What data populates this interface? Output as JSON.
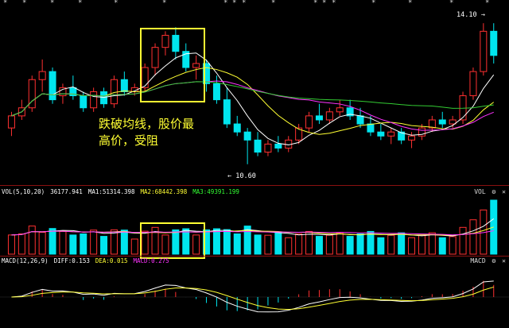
{
  "stars": [
    "*",
    "*",
    "*",
    "*",
    "*",
    "*",
    "*",
    "*",
    "*",
    "*",
    "*",
    "*",
    "*",
    "*",
    "*",
    "*",
    "*"
  ],
  "main": {
    "annotation_line1": "跌破均线，股价最",
    "annotation_line2": "高价，受阻",
    "high_label": "14.10",
    "low_label": "10.60"
  },
  "volume": {
    "title": "VOL(5,10,20)",
    "value": "36177.941",
    "ma1": "MA1:51314.398",
    "ma2": "MA2:68442.398",
    "ma3": "MA3:49391.199",
    "corner": "VOL"
  },
  "macd": {
    "title": "MACD(12,26,9)",
    "diff": "DIFF:0.153",
    "dea": "DEA:0.015",
    "macd_val": "MACD:0.275",
    "corner": "MACD"
  },
  "controls": {
    "settings": "⚙",
    "close": "✕"
  },
  "colors": {
    "up": "#ff3030",
    "down": "#00e5ee",
    "ma5": "#ffffff",
    "ma10": "#ffff33",
    "ma20": "#ff33ff",
    "ma60": "#33cc33",
    "box": "#ffff33",
    "grid": "#8a1010"
  },
  "chart_data": {
    "type": "candlestick",
    "ohlc_approx": [
      [
        11.5,
        11.9,
        11.3,
        11.8
      ],
      [
        11.8,
        12.2,
        11.7,
        12.0
      ],
      [
        12.0,
        12.8,
        11.9,
        12.7
      ],
      [
        12.7,
        13.2,
        12.4,
        12.9
      ],
      [
        12.9,
        13.0,
        12.1,
        12.2
      ],
      [
        12.3,
        12.6,
        12.1,
        12.5
      ],
      [
        12.5,
        12.8,
        12.2,
        12.3
      ],
      [
        12.3,
        12.4,
        11.9,
        12.0
      ],
      [
        12.0,
        12.5,
        11.9,
        12.4
      ],
      [
        12.4,
        12.5,
        12.0,
        12.1
      ],
      [
        12.1,
        12.8,
        12.0,
        12.7
      ],
      [
        12.7,
        12.9,
        12.3,
        12.4
      ],
      [
        12.4,
        12.6,
        12.3,
        12.5
      ],
      [
        12.5,
        13.1,
        12.4,
        13.0
      ],
      [
        13.0,
        13.6,
        12.8,
        13.5
      ],
      [
        13.5,
        13.9,
        13.3,
        13.8
      ],
      [
        13.8,
        14.0,
        13.2,
        13.4
      ],
      [
        13.4,
        13.6,
        12.9,
        13.0
      ],
      [
        13.0,
        13.3,
        12.7,
        13.1
      ],
      [
        13.1,
        13.2,
        12.4,
        12.6
      ],
      [
        12.6,
        12.8,
        12.1,
        12.2
      ],
      [
        12.2,
        12.5,
        11.5,
        11.6
      ],
      [
        11.6,
        11.8,
        11.3,
        11.4
      ],
      [
        11.4,
        11.5,
        10.6,
        11.2
      ],
      [
        11.2,
        11.4,
        10.8,
        10.9
      ],
      [
        10.9,
        11.2,
        10.8,
        11.1
      ],
      [
        11.1,
        11.3,
        10.9,
        11.0
      ],
      [
        11.0,
        11.3,
        10.9,
        11.2
      ],
      [
        11.2,
        11.6,
        11.1,
        11.5
      ],
      [
        11.5,
        11.9,
        11.4,
        11.8
      ],
      [
        11.8,
        12.1,
        11.6,
        11.7
      ],
      [
        11.7,
        12.0,
        11.6,
        11.9
      ],
      [
        11.9,
        12.2,
        11.8,
        12.0
      ],
      [
        12.0,
        12.2,
        11.7,
        11.8
      ],
      [
        11.8,
        12.0,
        11.5,
        11.6
      ],
      [
        11.6,
        11.8,
        11.3,
        11.4
      ],
      [
        11.4,
        11.6,
        11.2,
        11.3
      ],
      [
        11.3,
        11.5,
        11.1,
        11.4
      ],
      [
        11.4,
        11.5,
        11.1,
        11.2
      ],
      [
        11.2,
        11.4,
        11.0,
        11.3
      ],
      [
        11.3,
        11.6,
        11.2,
        11.5
      ],
      [
        11.5,
        11.8,
        11.4,
        11.7
      ],
      [
        11.7,
        11.9,
        11.5,
        11.6
      ],
      [
        11.6,
        11.8,
        11.5,
        11.7
      ],
      [
        11.7,
        12.4,
        11.6,
        12.3
      ],
      [
        12.3,
        13.0,
        12.2,
        12.9
      ],
      [
        12.9,
        14.1,
        12.8,
        13.9
      ],
      [
        13.9,
        14.1,
        13.1,
        13.3
      ]
    ]
  }
}
